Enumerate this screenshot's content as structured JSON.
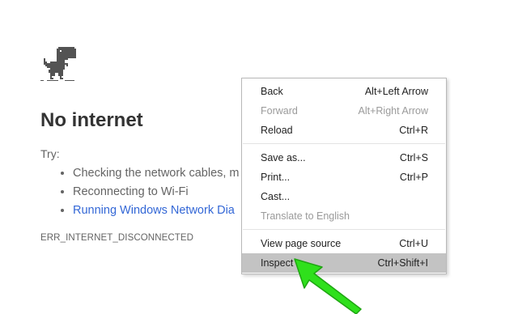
{
  "error_page": {
    "title": "No internet",
    "try_label": "Try:",
    "suggestions": [
      "Checking the network cables, m",
      "Reconnecting to Wi-Fi",
      "Running Windows Network Dia"
    ],
    "error_code": "ERR_INTERNET_DISCONNECTED"
  },
  "context_menu": {
    "items": [
      {
        "label": "Back",
        "shortcut": "Alt+Left Arrow",
        "enabled": true
      },
      {
        "label": "Forward",
        "shortcut": "Alt+Right Arrow",
        "enabled": false
      },
      {
        "label": "Reload",
        "shortcut": "Ctrl+R",
        "enabled": true
      },
      {
        "label": "Save as...",
        "shortcut": "Ctrl+S",
        "enabled": true
      },
      {
        "label": "Print...",
        "shortcut": "Ctrl+P",
        "enabled": true
      },
      {
        "label": "Cast...",
        "shortcut": "",
        "enabled": true
      },
      {
        "label": "Translate to English",
        "shortcut": "",
        "enabled": false
      },
      {
        "label": "View page source",
        "shortcut": "Ctrl+U",
        "enabled": true
      },
      {
        "label": "Inspect",
        "shortcut": "Ctrl+Shift+I",
        "enabled": true,
        "highlighted": true
      }
    ]
  },
  "colors": {
    "link": "#3367d6",
    "highlight": "#c3c3c3",
    "arrow": "#2fe01c",
    "text_muted": "#646464"
  },
  "icons": {
    "dino": "offline-dino-icon",
    "arrow": "green-arrow-annotation"
  }
}
